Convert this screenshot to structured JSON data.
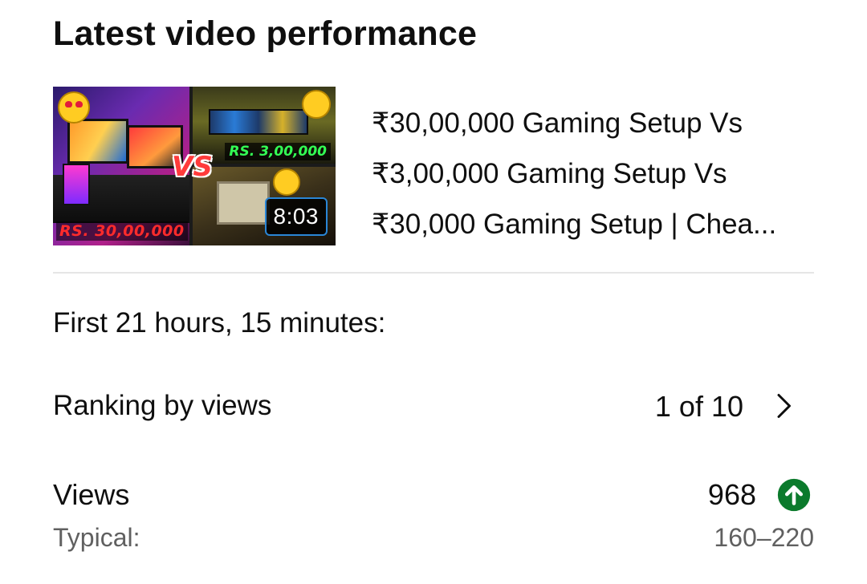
{
  "section": {
    "title": "Latest video performance"
  },
  "video": {
    "title_lines": [
      "₹30,00,000 Gaming Setup Vs",
      "₹3,00,000 Gaming Setup Vs",
      "₹30,000 Gaming Setup | Chea..."
    ],
    "duration": "8:03",
    "thumbnail": {
      "price_top_right": "RS. 3,00,000",
      "price_bottom_left": "RS. 30,00,000",
      "vs_text": "VS"
    }
  },
  "period": {
    "label": "First 21 hours, 15 minutes:"
  },
  "ranking": {
    "label": "Ranking by views",
    "value": "1 of 10",
    "icon": "chevron-right-icon"
  },
  "views": {
    "label": "Views",
    "value": "968",
    "trend_icon": "arrow-up-circle-icon",
    "trend_color": "#0b7a2c",
    "typical_label": "Typical:",
    "typical_value": "160–220"
  }
}
